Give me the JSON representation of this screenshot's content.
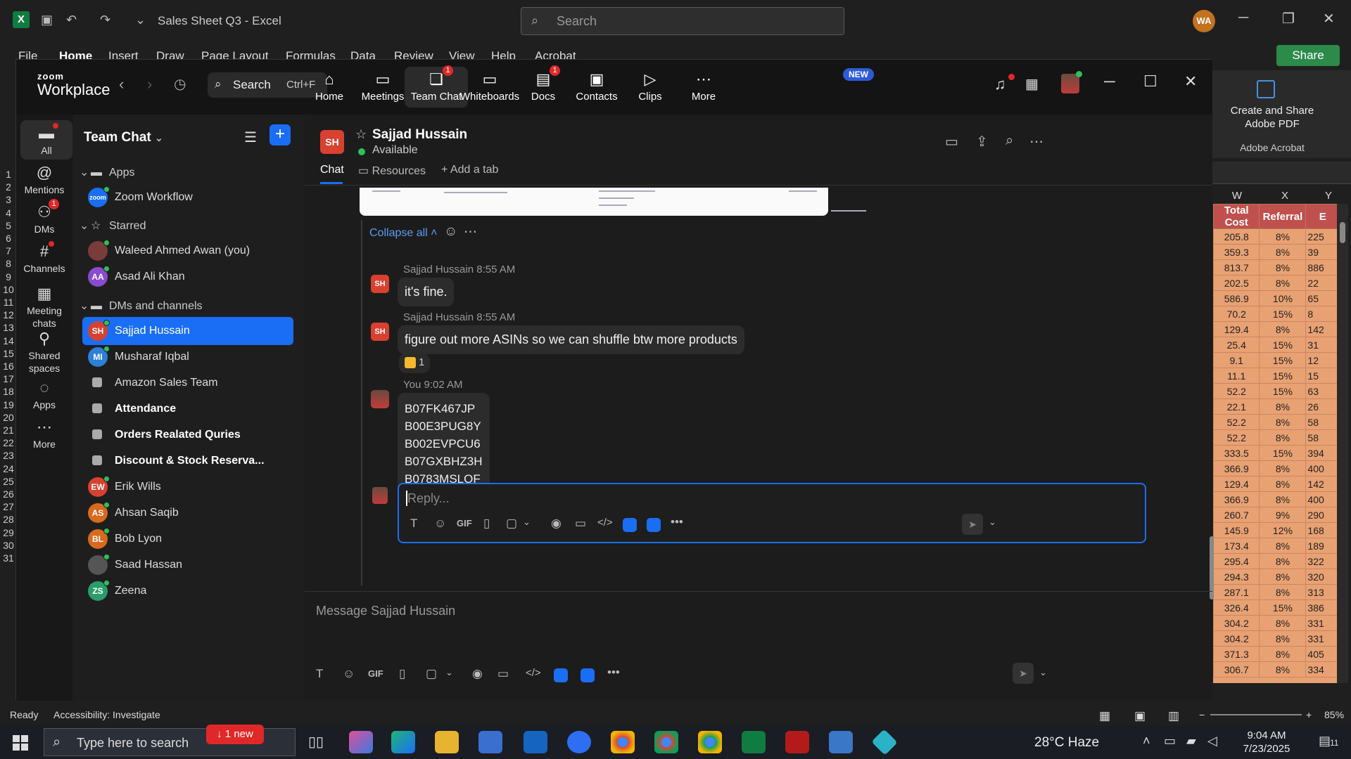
{
  "excel": {
    "doc_title": "Sales Sheet Q3  -  Excel",
    "search_placeholder": "Search",
    "avatar_initials": "WA",
    "ribbon_tabs": [
      "File",
      "Home",
      "Insert",
      "Draw",
      "Page Layout",
      "Formulas",
      "Data",
      "Review",
      "View",
      "Help",
      "Acrobat"
    ],
    "share_label": "Share",
    "acrobat_label": "Create and Share Adobe PDF",
    "acrobat_group": "Adobe Acrobat",
    "columns": [
      "W",
      "X",
      "Y"
    ],
    "headers": [
      "Total Cost",
      "Referral",
      "E"
    ],
    "row_numbers": [
      "1",
      "2",
      "3",
      "4",
      "5",
      "6",
      "7",
      "8",
      "9",
      "10",
      "11",
      "12",
      "13",
      "14",
      "15",
      "16",
      "17",
      "18",
      "19",
      "20",
      "21",
      "22",
      "23",
      "24",
      "25",
      "26",
      "27",
      "28",
      "29",
      "30",
      "31"
    ],
    "rows": [
      [
        "205.8",
        "8%",
        "225"
      ],
      [
        "359.3",
        "8%",
        "39"
      ],
      [
        "813.7",
        "8%",
        "886"
      ],
      [
        "202.5",
        "8%",
        "22"
      ],
      [
        "586.9",
        "10%",
        "65"
      ],
      [
        "70.2",
        "15%",
        "8"
      ],
      [
        "129.4",
        "8%",
        "142"
      ],
      [
        "25.4",
        "15%",
        "31"
      ],
      [
        "9.1",
        "15%",
        "12"
      ],
      [
        "11.1",
        "15%",
        "15"
      ],
      [
        "52.2",
        "15%",
        "63"
      ],
      [
        "22.1",
        "8%",
        "26"
      ],
      [
        "52.2",
        "8%",
        "58"
      ],
      [
        "52.2",
        "8%",
        "58"
      ],
      [
        "333.5",
        "15%",
        "394"
      ],
      [
        "366.9",
        "8%",
        "400"
      ],
      [
        "129.4",
        "8%",
        "142"
      ],
      [
        "366.9",
        "8%",
        "400"
      ],
      [
        "260.7",
        "9%",
        "290"
      ],
      [
        "145.9",
        "12%",
        "168"
      ],
      [
        "173.4",
        "8%",
        "189"
      ],
      [
        "295.4",
        "8%",
        "322"
      ],
      [
        "294.3",
        "8%",
        "320"
      ],
      [
        "287.1",
        "8%",
        "313"
      ],
      [
        "326.4",
        "15%",
        "386"
      ],
      [
        "304.2",
        "8%",
        "331"
      ],
      [
        "304.2",
        "8%",
        "331"
      ],
      [
        "371.3",
        "8%",
        "405"
      ],
      [
        "306.7",
        "8%",
        "334"
      ]
    ],
    "status": {
      "ready": "Ready",
      "accessibility": "Accessibility: Investigate",
      "zoom": "85%"
    }
  },
  "zoom": {
    "brand_top": "zoom",
    "brand_bottom": "Workplace",
    "search_label": "Search",
    "search_shortcut": "Ctrl+F",
    "nav_tabs": [
      {
        "label": "Home",
        "icon": "home-icon",
        "glyph": "⌂"
      },
      {
        "label": "Meetings",
        "icon": "video-icon",
        "glyph": "▭"
      },
      {
        "label": "Team Chat",
        "icon": "chat-icon",
        "glyph": "❏",
        "badge": "1"
      },
      {
        "label": "Whiteboards",
        "icon": "whiteboard-icon",
        "glyph": "▭"
      },
      {
        "label": "Docs",
        "icon": "docs-icon",
        "glyph": "▤",
        "badge": "1"
      },
      {
        "label": "Contacts",
        "icon": "contacts-icon",
        "glyph": "▣"
      },
      {
        "label": "Clips",
        "icon": "clips-icon",
        "glyph": "▷"
      },
      {
        "label": "More",
        "icon": "more-icon",
        "glyph": "⋯"
      }
    ],
    "new_badge": "NEW",
    "rail": [
      {
        "label": "All",
        "icon": "chat-bubble-icon",
        "glyph": "▬"
      },
      {
        "label": "Mentions",
        "icon": "at-icon",
        "glyph": "@"
      },
      {
        "label": "DMs",
        "icon": "people-icon",
        "glyph": "⚇",
        "badge": "1"
      },
      {
        "label": "Channels",
        "icon": "hash-icon",
        "glyph": "#"
      },
      {
        "label": "Meeting chats",
        "icon": "calendar-icon",
        "glyph": "▦"
      },
      {
        "label": "Shared spaces",
        "icon": "share-icon",
        "glyph": "⚲"
      },
      {
        "label": "Apps",
        "icon": "apps-icon",
        "glyph": "◌"
      },
      {
        "label": "More",
        "icon": "more-dots-icon",
        "glyph": "⋯"
      }
    ],
    "list": {
      "title": "Team Chat",
      "sections": {
        "apps": "Apps",
        "starred": "Starred",
        "dms": "DMs and channels"
      },
      "apps": [
        {
          "name": "Zoom Workflow",
          "initials": "zoom",
          "color": "#1a6ef5"
        }
      ],
      "starred": [
        {
          "name": "Waleed Ahmed Awan (you)",
          "initials": "",
          "color": "#7a3b3b"
        },
        {
          "name": "Asad Ali Khan",
          "initials": "AA",
          "color": "#8a4bcf"
        }
      ],
      "dms": [
        {
          "name": "Sajjad Hussain",
          "initials": "SH",
          "color": "#d8412f",
          "active": true
        },
        {
          "name": "Musharaf Iqbal",
          "initials": "MI",
          "color": "#2d7fd8"
        },
        {
          "name": "Amazon Sales Team",
          "lock": true
        },
        {
          "name": "Attendance",
          "lock": true,
          "bold": true
        },
        {
          "name": "Orders Realated Quries",
          "lock": true,
          "bold": true
        },
        {
          "name": "Discount & Stock Reserva...",
          "lock": true,
          "bold": true
        },
        {
          "name": "Erik Wills",
          "initials": "EW",
          "color": "#d8412f"
        },
        {
          "name": "Ahsan Saqib",
          "initials": "AS",
          "color": "#d86a1f"
        },
        {
          "name": "Bob Lyon",
          "initials": "BL",
          "color": "#d86a1f"
        },
        {
          "name": "Saad Hassan",
          "initials": "",
          "color": "#555"
        },
        {
          "name": "Zeena",
          "initials": "ZS",
          "color": "#2a9d6a"
        }
      ],
      "new_pill": "↓ 1 new"
    },
    "conversation": {
      "initials": "SH",
      "name": "Sajjad Hussain",
      "status": "Available",
      "tabs": [
        "Chat",
        "Resources",
        "+ Add a tab"
      ],
      "collapse_all": "Collapse all ˄",
      "messages": [
        {
          "author": "Sajjad Hussain",
          "time": "8:55 AM",
          "text": "it's fine."
        },
        {
          "author": "Sajjad Hussain",
          "time": "8:55 AM",
          "text": "figure out more ASINs so we can shuffle btw more products"
        }
      ],
      "reaction_count": "1",
      "my_message": {
        "author": "You",
        "time": "9:02 AM",
        "lines": [
          "B07FK467JP",
          "B00E3PUG8Y",
          "B002EVPCU6",
          "B07GXBHZ3H",
          "B0783MSLQF"
        ]
      },
      "reply_placeholder": "Reply...",
      "compose_placeholder": "Message Sajjad Hussain",
      "gif_label": "GIF"
    }
  },
  "taskbar": {
    "search_placeholder": "Type here to search",
    "weather": "28°C  Haze",
    "time": "9:04 AM",
    "date": "7/23/2025",
    "notif_count": "11"
  }
}
